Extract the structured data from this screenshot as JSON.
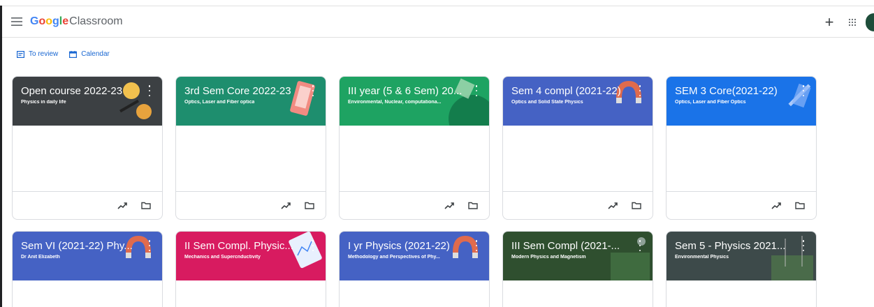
{
  "header": {
    "logo_google": "Google",
    "logo_app": "Classroom",
    "plus_label": "+"
  },
  "subnav": {
    "to_review": "To review",
    "calendar": "Calendar"
  },
  "colors": {
    "link_blue": "#1967d2",
    "dark_gray": "#3c4043",
    "teal": "#1e8e6e",
    "green": "#1ea362",
    "indigo": "#4562c4",
    "blue": "#1a73e8",
    "magenta": "#d81b60",
    "dark_green": "#2f4f2f",
    "slate": "#3d4a4a"
  },
  "cards": [
    {
      "title": "Open course 2022-23",
      "subtitle": "Physics in daily life",
      "color": "#3c4043",
      "icons": [
        "trending-icon",
        "folder-icon"
      ]
    },
    {
      "title": "3rd Sem Core 2022-23",
      "subtitle": "Optics, Laser and Fiber optica",
      "color": "#1e8e6e",
      "icons": [
        "trending-icon",
        "folder-icon"
      ]
    },
    {
      "title": "III year (5 & 6 Sem) 20...",
      "subtitle": "Environmental, Nuclear, computationa...",
      "color": "#1ea362",
      "icons": [
        "trending-icon",
        "folder-icon"
      ]
    },
    {
      "title": "Sem 4 compl (2021-22)",
      "subtitle": "Optics and Solid State Physics",
      "color": "#4562c4",
      "icons": [
        "trending-icon",
        "folder-icon"
      ]
    },
    {
      "title": "SEM 3 Core(2021-22)",
      "subtitle": "Optics, Laser and Fiber Optics",
      "color": "#1a73e8",
      "icons": [
        "trending-icon",
        "folder-icon"
      ]
    },
    {
      "title": "Sem VI (2021-22) Phy...",
      "subtitle": "Dr Anit Elizabeth",
      "color": "#4562c4"
    },
    {
      "title": "II Sem Compl. Physic...",
      "subtitle": "Mechanics and Supercnductivity",
      "color": "#d81b60"
    },
    {
      "title": "I yr Physics (2021-22)",
      "subtitle": "Methodology and Perspectives of Phy...",
      "color": "#4562c4"
    },
    {
      "title": "III Sem Compl (2021-...",
      "subtitle": "Modern Physics and Magnetism",
      "color": "#2f4f2f"
    },
    {
      "title": "Sem 5 - Physics 2021...",
      "subtitle": "Environmental Physics",
      "color": "#3d4a4a"
    }
  ]
}
